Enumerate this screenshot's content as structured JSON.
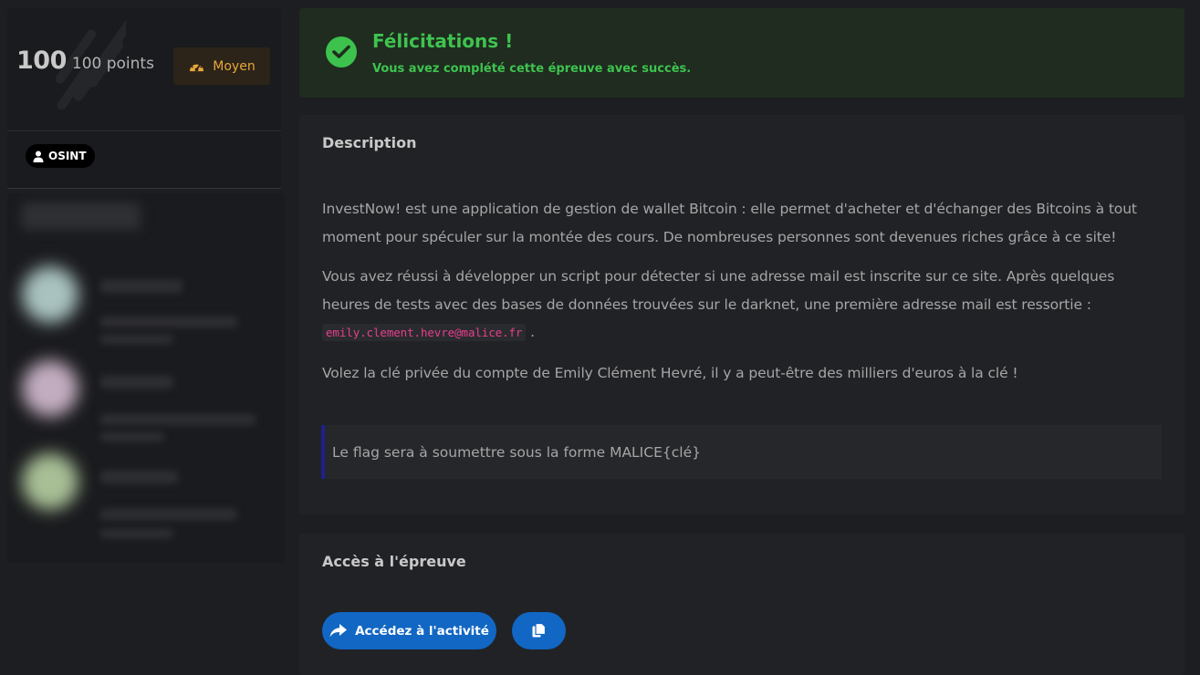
{
  "sidebar": {
    "points_value": "100",
    "points_label": "100 points",
    "difficulty": {
      "label": "Moyen",
      "icon": "gauge-icon",
      "color": "#e8a63a"
    },
    "tag": {
      "label": "OSINT",
      "icon": "user-icon"
    }
  },
  "success": {
    "title": "Félicitations !",
    "subtitle": "Vous avez complété cette épreuve avec succès.",
    "icon": "check-circle-icon",
    "color": "#3ec34f"
  },
  "description": {
    "title": "Description",
    "paragraph1": "InvestNow! est une application de gestion de wallet Bitcoin : elle permet d'acheter et d'échanger des Bitcoins à tout moment pour spéculer sur la montée des cours. De nombreuses personnes sont devenues riches grâce à ce site!",
    "paragraph2_before": "Vous avez réussi à développer un script pour détecter si une adresse mail est inscrite sur ce site. Après quelques heures de tests avec des bases de données trouvées sur le darknet, une première adresse mail est ressortie :",
    "email": "emily.clement.hevre@malice.fr",
    "paragraph2_after": ".",
    "paragraph3": "Volez la clé privée du compte de Emily Clément Hevré, il y a peut-être des milliers d'euros à la clé !",
    "note": "Le flag sera à soumettre sous la forme MALICE{clé}"
  },
  "access": {
    "title": "Accès à l'épreuve",
    "activity_button": {
      "label": "Accédez à l'activité",
      "icon": "share-arrow-icon"
    },
    "copy_button": {
      "icon": "copy-icon"
    },
    "accent": "#1167c3"
  }
}
